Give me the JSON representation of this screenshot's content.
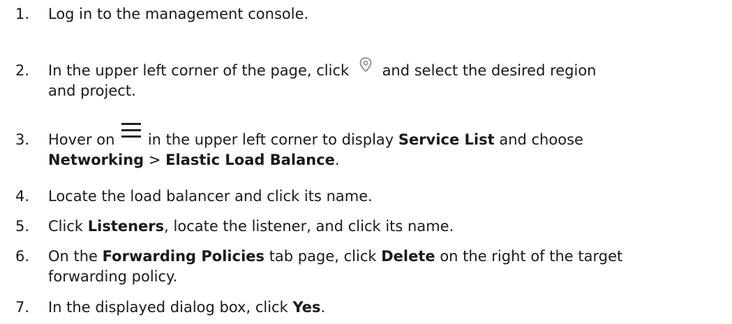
{
  "steps": [
    {
      "number": "1.",
      "text": "Log in to the management console."
    },
    {
      "number": "2.",
      "text_before": "In the upper left corner of the page, click",
      "icon": "location-pin-icon",
      "text_after": "and select the desired region",
      "line2": "and project."
    },
    {
      "number": "3.",
      "text_before": "Hover on",
      "icon": "hamburger-menu-icon",
      "text_mid": "in the upper left corner to display",
      "bold1": "Service List",
      "text_after": "and choose",
      "bold2": "Networking",
      "separator": ">",
      "bold3": "Elastic Load Balance",
      "end": "."
    },
    {
      "number": "4.",
      "text": "Locate the load balancer and click its name."
    },
    {
      "number": "5.",
      "text_before": "Click",
      "bold1": "Listeners",
      "text_after": ", locate the listener, and click its name."
    },
    {
      "number": "6.",
      "text_before": "On the",
      "bold1": "Forwarding Policies",
      "text_mid": "tab page, click",
      "bold2": "Delete",
      "text_after": "on the right of the target",
      "line2": "forwarding policy."
    },
    {
      "number": "7.",
      "text_before": "In the displayed dialog box, click",
      "bold1": "Yes",
      "end": "."
    }
  ],
  "colors": {
    "text": "#1a1a1a",
    "icon": "#8a8a8a",
    "menu_icon": "#222222"
  }
}
